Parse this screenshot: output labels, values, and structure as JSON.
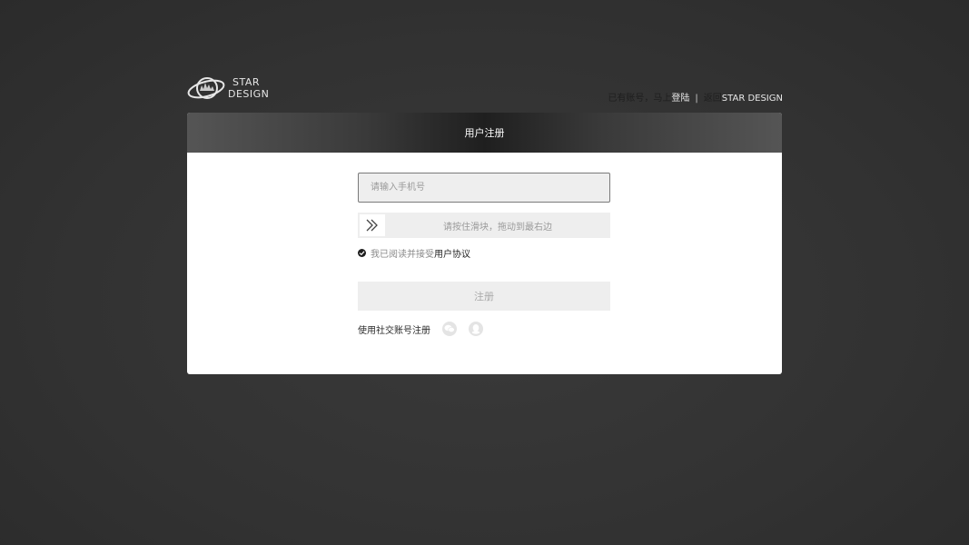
{
  "brand": {
    "line1": "STAR",
    "line2": "DESIGN"
  },
  "top_links": {
    "has_account": "已有账号，马上",
    "login": "登陆",
    "separator": "|",
    "back": "返回",
    "site": "STAR DESIGN"
  },
  "card": {
    "title": "用户注册"
  },
  "form": {
    "phone_placeholder": "请输入手机号",
    "phone_value": "",
    "slider_text": "请按住滑块，拖动到最右边",
    "agree_text": "我已阅读并接受",
    "agree_link": "用户协议",
    "submit_label": "注册"
  },
  "social": {
    "label": "使用社交账号注册",
    "icons": [
      "wechat-icon",
      "qq-icon"
    ]
  },
  "colors": {
    "background": "#363636",
    "card": "#ffffff",
    "field": "#eeeeee",
    "accent_text": "#1e1e1e"
  }
}
